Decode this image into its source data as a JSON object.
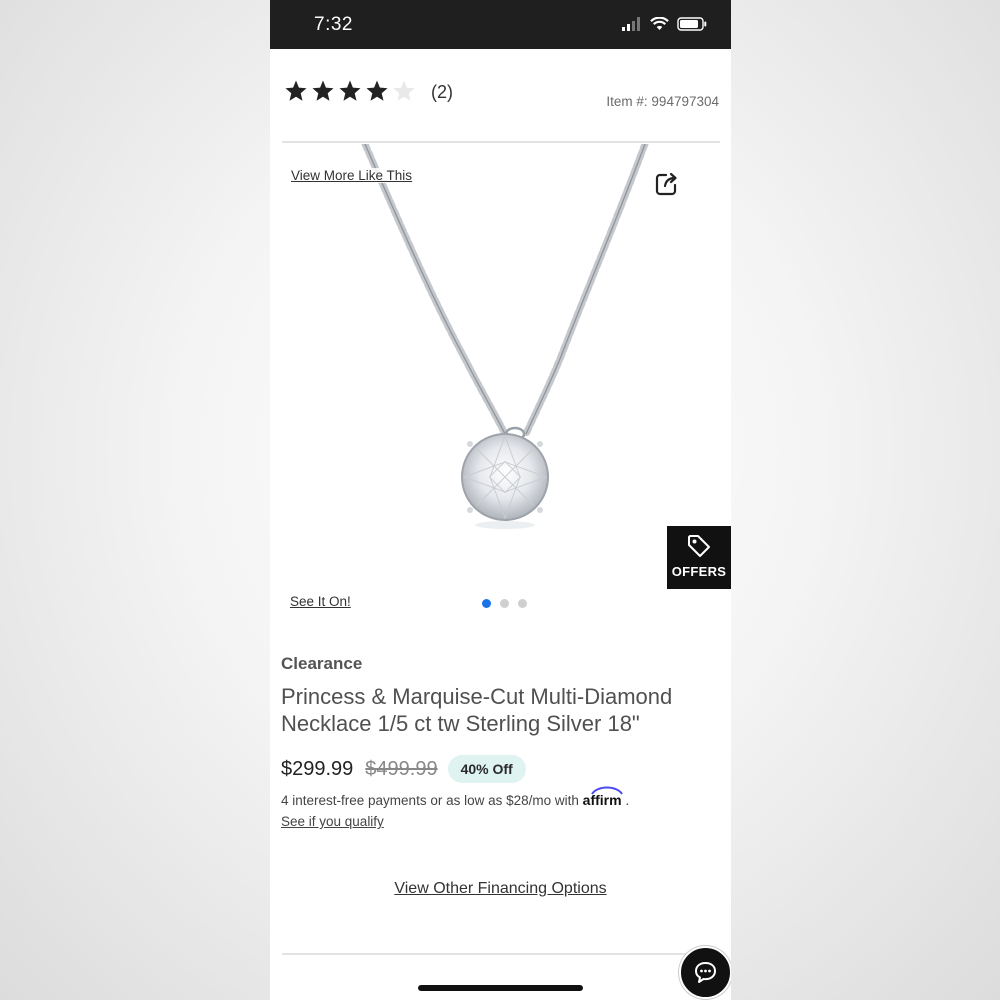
{
  "status_bar": {
    "time": "7:32"
  },
  "rating": {
    "stars_filled": 4,
    "stars_total": 5,
    "count": "(2)"
  },
  "item_number": "Item #: 994797304",
  "image": {
    "view_more_label": "View More Like This",
    "see_it_on_label": "See It On!",
    "carousel_total": 3,
    "carousel_active": 1
  },
  "offers_label": "OFFERS",
  "product": {
    "badge": "Clearance",
    "title": "Princess & Marquise-Cut Multi-Diamond Necklace 1/5 ct tw Sterling Silver 18\""
  },
  "pricing": {
    "price": "$299.99",
    "original_price": "$499.99",
    "discount": "40% Off"
  },
  "financing": {
    "installments_text": "4 interest-free payments or as low as $28/mo with",
    "affirm_logo": "affirm",
    "affirm_period": ".",
    "qualify_link": "See if you qualify",
    "other_options_link": "View Other Financing Options"
  },
  "icons": {
    "signal": "signal-icon",
    "wifi": "wifi-icon",
    "battery": "battery-icon",
    "share": "share-icon",
    "tag": "tag-icon",
    "chat": "chat-icon"
  },
  "colors": {
    "accent_blue": "#1a73e8",
    "discount_bg": "#dff3f1",
    "status_bar": "#1f1f1f"
  }
}
